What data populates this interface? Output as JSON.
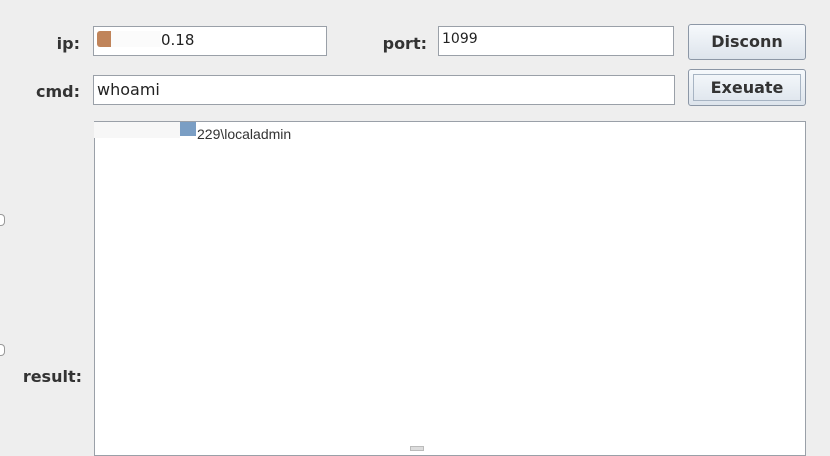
{
  "form": {
    "ip": {
      "label": "ip:",
      "value": "0.18"
    },
    "port": {
      "label": "port:",
      "value": "1099"
    },
    "cmd": {
      "label": "cmd:",
      "value": "whoami"
    },
    "result": {
      "label": "result:",
      "text": "229\\localadmin"
    }
  },
  "buttons": {
    "disconnect_label": "Disconn",
    "execute_label": "Exeuate"
  },
  "colors": {
    "window_background": "#eeeeee",
    "field_border": "#9aa0a8",
    "redaction_orange": "#c0845a",
    "redaction_blue": "#7a9ec4"
  }
}
